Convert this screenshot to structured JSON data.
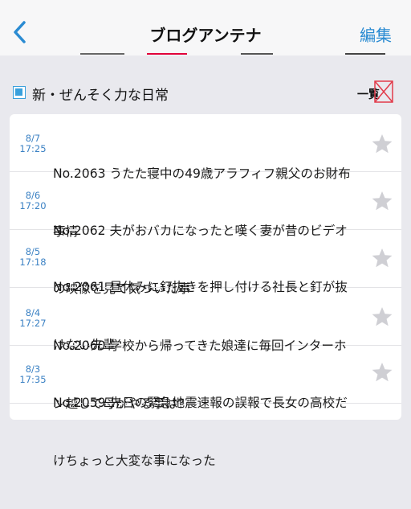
{
  "nav": {
    "back_icon": "chevron-left-icon",
    "title": "ブログアンテナ",
    "edit_label": "編集"
  },
  "colors": {
    "accent": "#2a8bd2",
    "date_text": "#3c82c4",
    "star": "#cfcfd4",
    "broken_image": "#e23b4a"
  },
  "section": {
    "checkbox_icon": "checkbox-icon",
    "title": "新・ぜんそく力な日常",
    "list_label": "一覧",
    "image_icon": "broken-image-icon"
  },
  "entries": [
    {
      "date": "8/7",
      "time": "17:25",
      "title_line1": "No.2063 うたた寝中の49歳アラフィフ親父のお財布",
      "title_line2": "事情"
    },
    {
      "date": "8/6",
      "time": "17:20",
      "title_line1": "No.2062 夫がおバカになったと嘆く妻が昔のビデオ",
      "title_line2": "の映像を見て気づいた事"
    },
    {
      "date": "8/5",
      "time": "17:18",
      "title_line1": "No.2061 昼休みに釘抜きを押し付ける社長と釘が抜",
      "title_line2": "けない先輩"
    },
    {
      "date": "8/4",
      "time": "17:27",
      "title_line1": "No.2060 学校から帰ってきた娘達に毎回インターホ",
      "title_line2": "ン越して母がやる事は？"
    },
    {
      "date": "8/3",
      "time": "17:35",
      "title_line1": "No.2059 先日の緊急地震速報の誤報で長女の高校だ",
      "title_line2": "けちょっと大変な事になった"
    }
  ]
}
